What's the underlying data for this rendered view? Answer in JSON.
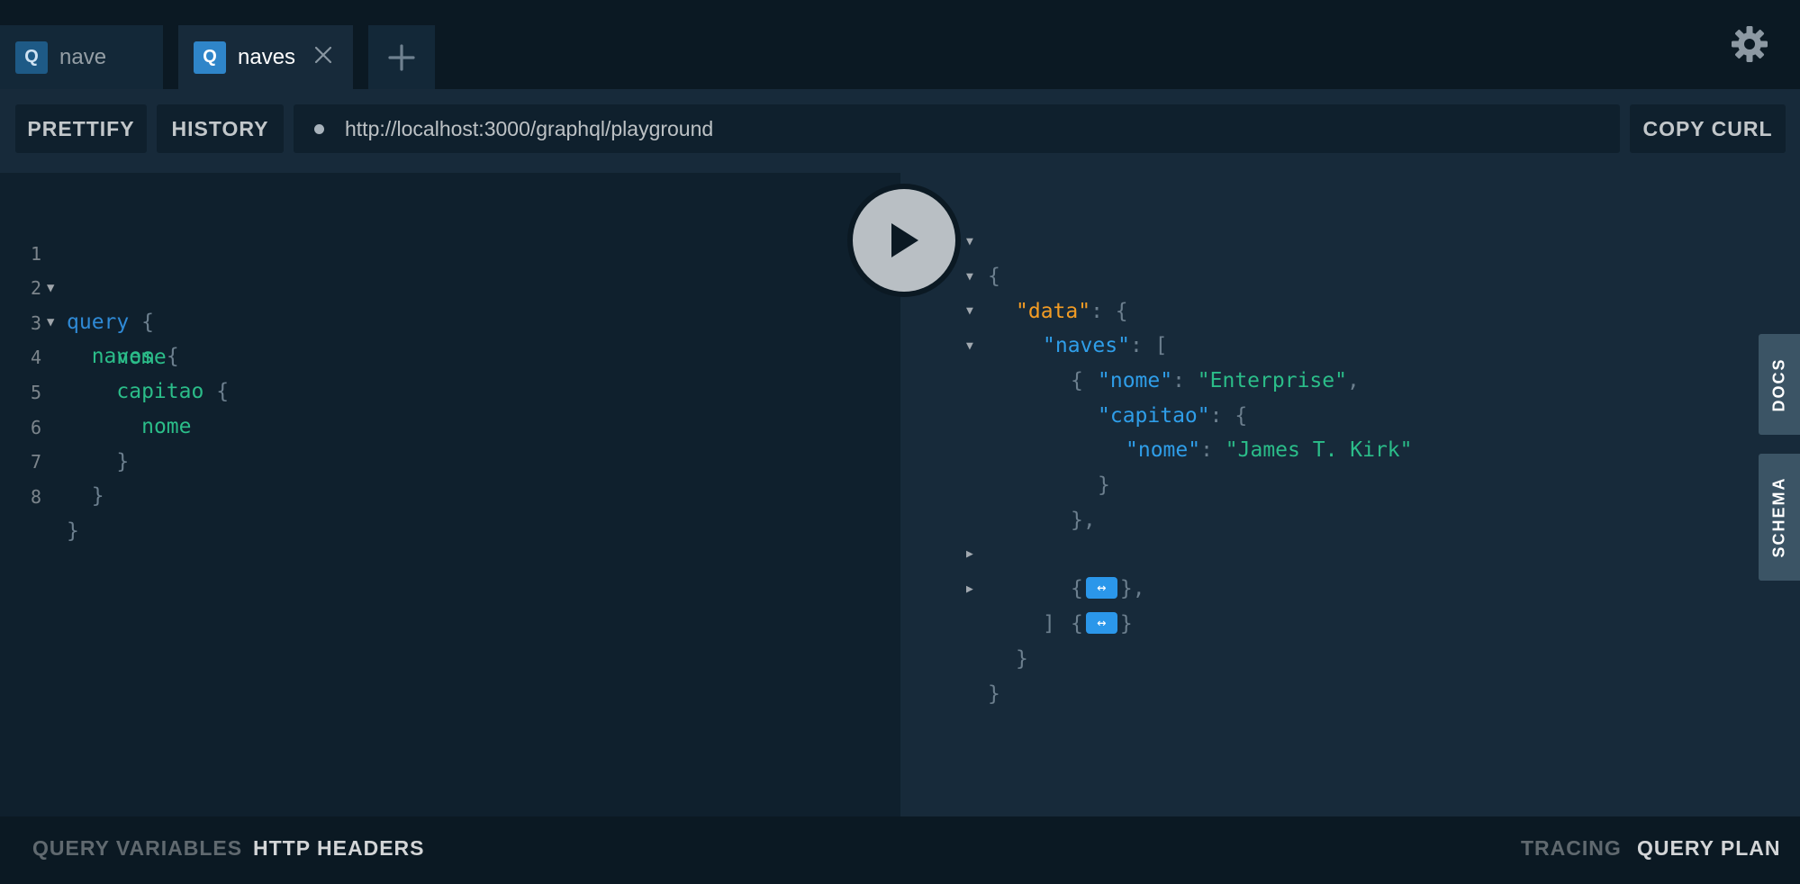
{
  "tabs": [
    {
      "badge": "Q",
      "title": "nave",
      "active": false
    },
    {
      "badge": "Q",
      "title": "naves",
      "active": true
    }
  ],
  "icons": {
    "close": "close-icon",
    "add": "plus-icon",
    "settings": "gear-icon",
    "run": "play-icon",
    "status_dot": "status-dot-icon"
  },
  "toolbar": {
    "prettify": "PRETTIFY",
    "history": "HISTORY",
    "url": "http://localhost:3000/graphql/playground",
    "copy_curl": "COPY CURL"
  },
  "editor": {
    "line_numbers": [
      "1",
      "2",
      "3",
      "4",
      "5",
      "6",
      "7",
      "8"
    ],
    "lines": [
      {
        "kw": "query",
        "punct": "{"
      },
      {
        "field": "naves",
        "punct": "{"
      },
      {
        "field": "nome"
      },
      {
        "field": "capitao",
        "punct": "{"
      },
      {
        "field": "nome"
      },
      {
        "punct": "}"
      },
      {
        "punct": "}"
      },
      {
        "punct": "}"
      }
    ]
  },
  "result": {
    "open_brace": "{",
    "data_key": "\"data\"",
    "colon_brace": ": {",
    "naves_key": "\"naves\"",
    "colon_bracket": ": [",
    "item_open": "{",
    "nome_key": "\"nome\"",
    "nome_value": "\"Enterprise\"",
    "comma": ",",
    "capitao_key": "\"capitao\"",
    "capitao_nome_key": "\"nome\"",
    "capitao_nome_value": "\"James T. Kirk\"",
    "inner_close": "}",
    "item_close": "},",
    "collapsed_open": "{",
    "collapsed_close_comma": "},",
    "collapsed_close": "}",
    "expander": "↔",
    "array_close": "]",
    "data_close": "}",
    "root_close": "}"
  },
  "side_tabs": {
    "docs": "DOCS",
    "schema": "SCHEMA"
  },
  "bottom": {
    "query_variables": "QUERY VARIABLES",
    "http_headers": "HTTP HEADERS",
    "tracing": "TRACING",
    "query_plan": "QUERY PLAN"
  },
  "colors": {
    "background": "#0f202d",
    "keyword": "#2f8ad6",
    "field": "#2bbd89",
    "json_key": "#2f9ee9",
    "data_key": "#f39c24",
    "string": "#2bbd89"
  }
}
